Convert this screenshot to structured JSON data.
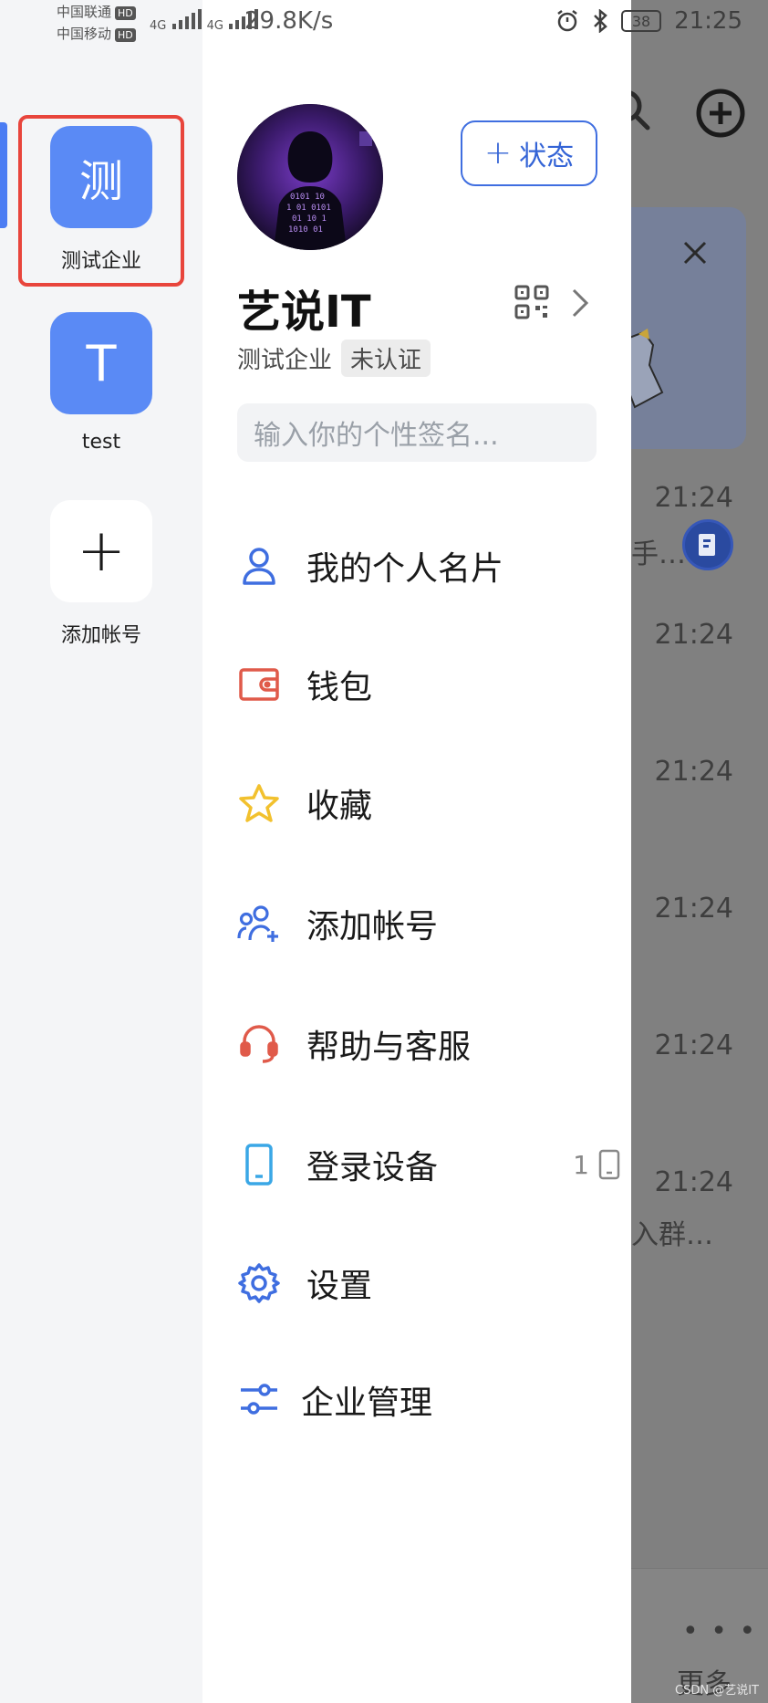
{
  "status_bar": {
    "carrier1": "中国联通",
    "carrier2": "中国移动",
    "hd": "HD",
    "net": "4G",
    "speed": "29.8K/s",
    "battery": "38",
    "time": "21:25"
  },
  "accounts": [
    {
      "initial": "测",
      "name": "测试企业",
      "active": true
    },
    {
      "initial": "T",
      "name": "test",
      "active": false
    },
    {
      "initial": "+",
      "name": "添加帐号",
      "active": false
    }
  ],
  "profile": {
    "name": "艺说IT",
    "org": "测试企业",
    "verify_tag": "未认证",
    "status_button": "状态",
    "signature_placeholder": "输入你的个性签名..."
  },
  "menu": {
    "card": "我的个人名片",
    "wallet": "钱包",
    "favorites": "收藏",
    "add_account": "添加帐号",
    "help": "帮助与客服",
    "devices": "登录设备",
    "devices_count": "1",
    "settings": "设置",
    "enterprise": "企业管理"
  },
  "background_chats": {
    "times": [
      "21:24",
      "21:24",
      "21:24",
      "21:24",
      "21:24",
      "21:24"
    ],
    "snippet1": "手…",
    "snippet2": "入群…",
    "more": "更多"
  },
  "watermark": "CSDN @艺说IT",
  "colors": {
    "accent": "#3f6ee0",
    "highlight": "#e8453c",
    "wallet": "#e05a4a",
    "star": "#f2c12e",
    "device": "#3aa7e6"
  }
}
